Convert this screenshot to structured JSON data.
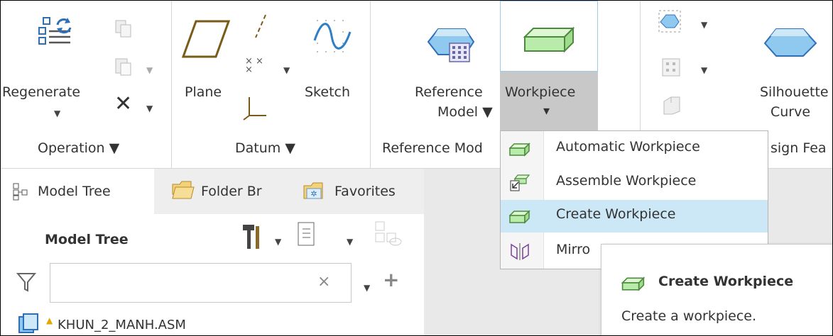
{
  "ribbon": {
    "operation": {
      "regenerate_label": "Regenerate",
      "group_label": "Operation ▼"
    },
    "datum": {
      "plane_label": "Plane",
      "sketch_label": "Sketch",
      "group_label": "Datum ▼"
    },
    "reference_model": {
      "button_line1": "Reference",
      "button_line2": "Model ▼",
      "group_label": "Reference Mod"
    },
    "workpiece": {
      "label": "Workpiece",
      "caret": "▾"
    },
    "design": {
      "silhouette_line1": "Silhouette",
      "silhouette_line2": "Curve",
      "group_label": "sign Fea"
    }
  },
  "workpiece_menu": {
    "items": [
      {
        "label": "Automatic Workpiece",
        "icon": "block-icon"
      },
      {
        "label": "Assemble Workpiece",
        "icon": "assemble-icon"
      },
      {
        "label": "Create Workpiece",
        "icon": "block-icon",
        "highlighted": true
      },
      {
        "label": "Mirro",
        "icon": "mirror-icon"
      }
    ]
  },
  "tooltip": {
    "title": "Create Workpiece",
    "description": "Create a workpiece."
  },
  "panel": {
    "tabs": [
      {
        "label": "Model Tree"
      },
      {
        "label": "Folder Br"
      },
      {
        "label": "Favorites"
      }
    ],
    "title": "Model Tree",
    "search_clear": "×",
    "add_symbol": "+",
    "tree_root": "KHUN_2_MANH.ASM",
    "warning_symbol": "▲"
  },
  "colors": {
    "accent_blue": "#3f8fd2",
    "menu_highlight": "#cce8f6",
    "workpiece_green": "#b9ecaa",
    "button_pressed": "#c8c8c8"
  }
}
